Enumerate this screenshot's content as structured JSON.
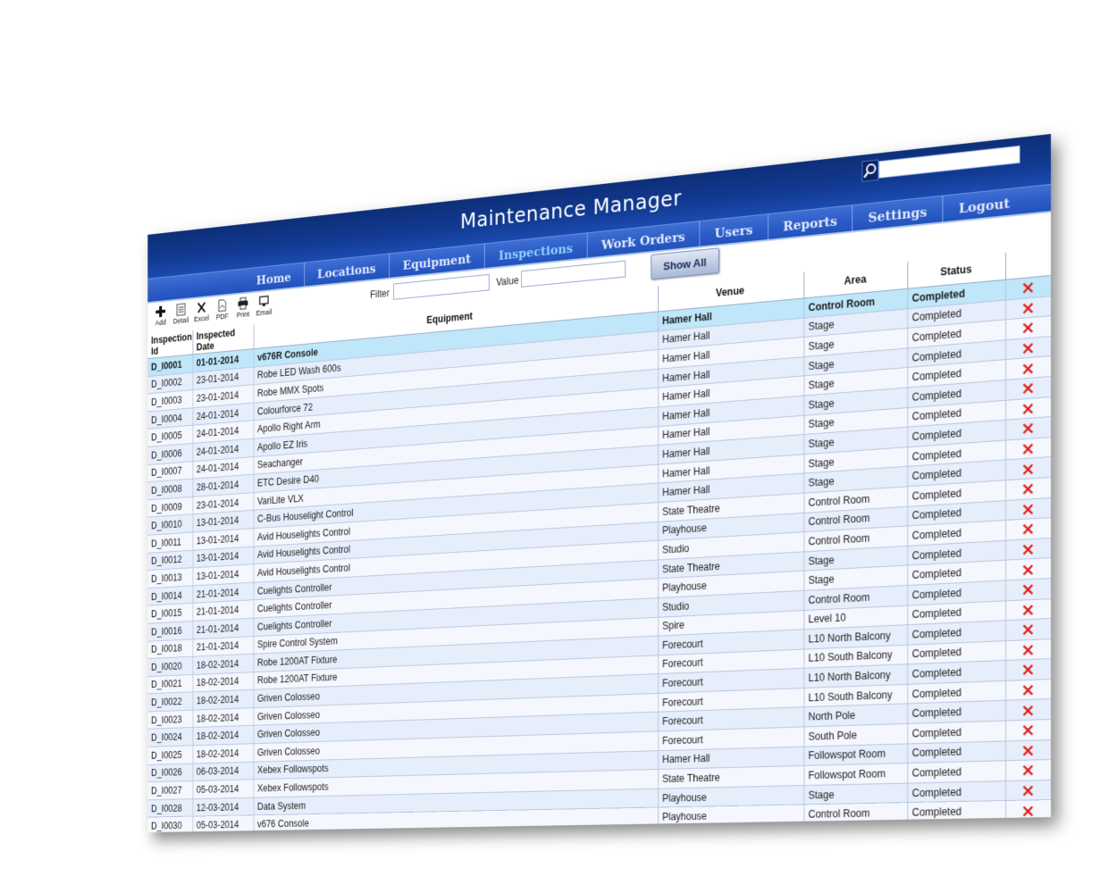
{
  "app": {
    "title": "Maintenance Manager"
  },
  "search": {
    "placeholder": ""
  },
  "nav": {
    "items": [
      {
        "label": "Home",
        "active": false
      },
      {
        "label": "Locations",
        "active": false
      },
      {
        "label": "Equipment",
        "active": false
      },
      {
        "label": "Inspections",
        "active": true
      },
      {
        "label": "Work Orders",
        "active": false
      },
      {
        "label": "Users",
        "active": false
      },
      {
        "label": "Reports",
        "active": false
      },
      {
        "label": "Settings",
        "active": false
      },
      {
        "label": "Logout",
        "active": false
      }
    ]
  },
  "toolbar": {
    "add_label": "Add",
    "detail_label": "Detail",
    "excel_label": "Excel",
    "pdf_label": "PDF",
    "print_label": "Print",
    "email_label": "Email",
    "filter_label": "Filter",
    "filter_value": "",
    "value_label": "Value",
    "value_value": "",
    "show_all_label": "Show All"
  },
  "table": {
    "headers": {
      "id": "Inspection Id",
      "date": "Inspected Date",
      "equipment": "Equipment",
      "venue": "Venue",
      "area": "Area",
      "status": "Status"
    },
    "rows": [
      {
        "id": "D_I0001",
        "date": "01-01-2014",
        "equipment": "v676R Console",
        "venue": "Hamer Hall",
        "area": "Control Room",
        "status": "Completed",
        "selected": true
      },
      {
        "id": "D_I0002",
        "date": "23-01-2014",
        "equipment": "Robe LED Wash 600s",
        "venue": "Hamer Hall",
        "area": "Stage",
        "status": "Completed"
      },
      {
        "id": "D_I0003",
        "date": "23-01-2014",
        "equipment": "Robe MMX Spots",
        "venue": "Hamer Hall",
        "area": "Stage",
        "status": "Completed"
      },
      {
        "id": "D_I0004",
        "date": "24-01-2014",
        "equipment": "Colourforce 72",
        "venue": "Hamer Hall",
        "area": "Stage",
        "status": "Completed"
      },
      {
        "id": "D_I0005",
        "date": "24-01-2014",
        "equipment": "Apollo Right Arm",
        "venue": "Hamer Hall",
        "area": "Stage",
        "status": "Completed"
      },
      {
        "id": "D_I0006",
        "date": "24-01-2014",
        "equipment": "Apollo EZ Iris",
        "venue": "Hamer Hall",
        "area": "Stage",
        "status": "Completed"
      },
      {
        "id": "D_I0007",
        "date": "24-01-2014",
        "equipment": "Seachanger",
        "venue": "Hamer Hall",
        "area": "Stage",
        "status": "Completed"
      },
      {
        "id": "D_I0008",
        "date": "28-01-2014",
        "equipment": "ETC Desire D40",
        "venue": "Hamer Hall",
        "area": "Stage",
        "status": "Completed"
      },
      {
        "id": "D_I0009",
        "date": "23-01-2014",
        "equipment": "VariLite VLX",
        "venue": "Hamer Hall",
        "area": "Stage",
        "status": "Completed"
      },
      {
        "id": "D_I0010",
        "date": "13-01-2014",
        "equipment": "C-Bus Houselight Control",
        "venue": "Hamer Hall",
        "area": "Stage",
        "status": "Completed"
      },
      {
        "id": "D_I0011",
        "date": "13-01-2014",
        "equipment": "Avid Houselights Control",
        "venue": "State Theatre",
        "area": "Control Room",
        "status": "Completed"
      },
      {
        "id": "D_I0012",
        "date": "13-01-2014",
        "equipment": "Avid Houselights Control",
        "venue": "Playhouse",
        "area": "Control Room",
        "status": "Completed"
      },
      {
        "id": "D_I0013",
        "date": "13-01-2014",
        "equipment": "Avid Houselights Control",
        "venue": "Studio",
        "area": "Control Room",
        "status": "Completed"
      },
      {
        "id": "D_I0014",
        "date": "21-01-2014",
        "equipment": "Cuelights Controller",
        "venue": "State Theatre",
        "area": "Stage",
        "status": "Completed"
      },
      {
        "id": "D_I0015",
        "date": "21-01-2014",
        "equipment": "Cuelights Controller",
        "venue": "Playhouse",
        "area": "Stage",
        "status": "Completed"
      },
      {
        "id": "D_I0016",
        "date": "21-01-2014",
        "equipment": "Cuelights Controller",
        "venue": "Studio",
        "area": "Control Room",
        "status": "Completed"
      },
      {
        "id": "D_I0018",
        "date": "21-01-2014",
        "equipment": "Spire Control System",
        "venue": "Spire",
        "area": "Level 10",
        "status": "Completed"
      },
      {
        "id": "D_I0020",
        "date": "18-02-2014",
        "equipment": "Robe 1200AT Fixture",
        "venue": "Forecourt",
        "area": "L10 North Balcony",
        "status": "Completed"
      },
      {
        "id": "D_I0021",
        "date": "18-02-2014",
        "equipment": "Robe 1200AT Fixture",
        "venue": "Forecourt",
        "area": "L10 South Balcony",
        "status": "Completed"
      },
      {
        "id": "D_I0022",
        "date": "18-02-2014",
        "equipment": "Griven Colosseo",
        "venue": "Forecourt",
        "area": "L10 North Balcony",
        "status": "Completed"
      },
      {
        "id": "D_I0023",
        "date": "18-02-2014",
        "equipment": "Griven Colosseo",
        "venue": "Forecourt",
        "area": "L10 South Balcony",
        "status": "Completed"
      },
      {
        "id": "D_I0024",
        "date": "18-02-2014",
        "equipment": "Griven Colosseo",
        "venue": "Forecourt",
        "area": "North Pole",
        "status": "Completed"
      },
      {
        "id": "D_I0025",
        "date": "18-02-2014",
        "equipment": "Griven Colosseo",
        "venue": "Forecourt",
        "area": "South Pole",
        "status": "Completed"
      },
      {
        "id": "D_I0026",
        "date": "06-03-2014",
        "equipment": "Xebex Followspots",
        "venue": "Hamer Hall",
        "area": "Followspot Room",
        "status": "Completed"
      },
      {
        "id": "D_I0027",
        "date": "05-03-2014",
        "equipment": "Xebex Followspots",
        "venue": "State Theatre",
        "area": "Followspot Room",
        "status": "Completed"
      },
      {
        "id": "D_I0028",
        "date": "12-03-2014",
        "equipment": "Data System",
        "venue": "Playhouse",
        "area": "Stage",
        "status": "Completed"
      },
      {
        "id": "D_I0030",
        "date": "05-03-2014",
        "equipment": "v676 Console",
        "venue": "Playhouse",
        "area": "Control Room",
        "status": "Completed"
      }
    ]
  },
  "colors": {
    "header_dark": "#0e2f78",
    "nav_blue": "#2c5cc6",
    "active_tab": "#8fd0ff",
    "selected_row": "#bfe6f9",
    "delete_red": "#e0201b"
  }
}
